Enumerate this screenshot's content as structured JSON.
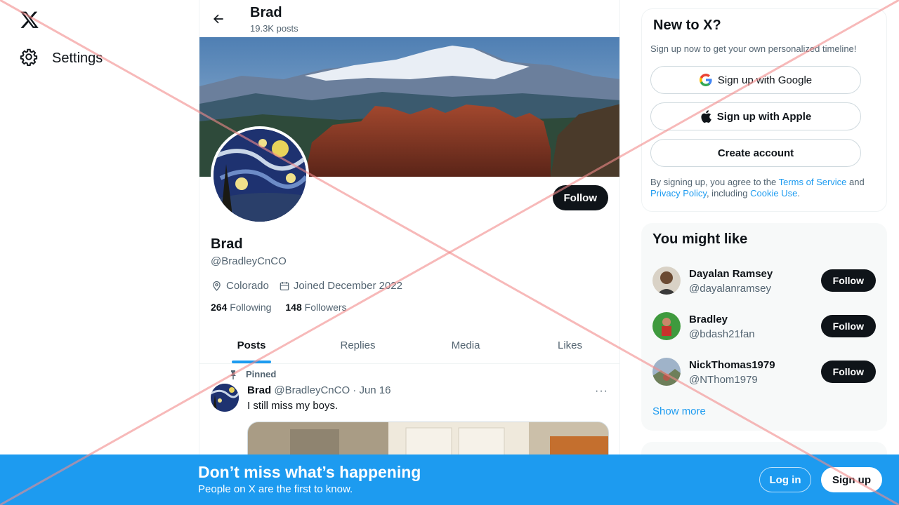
{
  "nav": {
    "settings_label": "Settings"
  },
  "profile": {
    "top_name": "Brad",
    "post_count": "19.3K posts",
    "name": "Brad",
    "handle": "@BradleyCnCO",
    "location": "Colorado",
    "joined": "Joined December 2022",
    "following_count": "264",
    "following_label": "Following",
    "followers_count": "148",
    "followers_label": "Followers",
    "follow_label": "Follow"
  },
  "tabs": [
    "Posts",
    "Replies",
    "Media",
    "Likes"
  ],
  "post": {
    "pinned_label": "Pinned",
    "author": "Brad",
    "meta": "@BradleyCnCO · Jun 16",
    "text": "I still miss my boys.",
    "more": "···"
  },
  "signup_card": {
    "title": "New to X?",
    "subtitle": "Sign up now to get your own personalized timeline!",
    "google": "Sign up with Google",
    "apple": "Sign up with Apple",
    "create": "Create account",
    "terms_pre": "By signing up, you agree to the ",
    "terms_link": "Terms of Service",
    "terms_and": " and ",
    "privacy_link": "Privacy Policy",
    "terms_mid": ", including ",
    "cookie_link": "Cookie Use",
    "terms_end": "."
  },
  "might_like": {
    "title": "You might like",
    "follow_label": "Follow",
    "users": [
      {
        "name": "Dayalan Ramsey",
        "handle": "@dayalanramsey"
      },
      {
        "name": "Bradley",
        "handle": "@bdash21fan"
      },
      {
        "name": "NickThomas1979",
        "handle": "@NThom1979"
      }
    ],
    "show_more": "Show more"
  },
  "bottom_bar": {
    "title": "Don’t miss what’s happening",
    "subtitle": "People on X are the first to know.",
    "login": "Log in",
    "signup": "Sign up"
  },
  "colors": {
    "accent": "#1d9bf0",
    "text": "#0f1419",
    "muted": "#536471",
    "overlay_x": "#f4a6a6"
  }
}
